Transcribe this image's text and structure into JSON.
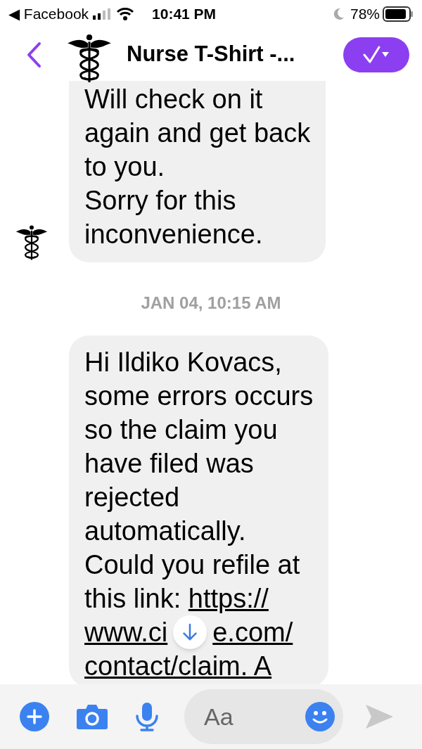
{
  "status_bar": {
    "back_app": "◀ Facebook",
    "time": "10:41 PM",
    "battery": "78%"
  },
  "header": {
    "title": "Nurse T-Shirt -..."
  },
  "messages": [
    {
      "kind": "bubble",
      "avatar": true,
      "lines": [
        [
          {
            "text": "Will check on it"
          }
        ],
        [
          {
            "text": "again and get back"
          }
        ],
        [
          {
            "text": "to you."
          }
        ],
        [
          {
            "text": "Sorry for this"
          }
        ],
        [
          {
            "text": "inconvenience."
          }
        ]
      ]
    },
    {
      "kind": "timestamp",
      "text": "JAN 04, 10:15 AM"
    },
    {
      "kind": "bubble",
      "avatar": false,
      "lines": [
        [
          {
            "text": "Hi Ildiko Kovacs,"
          }
        ],
        [
          {
            "text": "some errors occurs"
          }
        ],
        [
          {
            "text": "so the claim you"
          }
        ],
        [
          {
            "text": "have filed was"
          }
        ],
        [
          {
            "text": "rejected"
          }
        ],
        [
          {
            "text": "automatically."
          }
        ],
        [
          {
            "text": "Could you refile at"
          }
        ],
        [
          {
            "text": "this link: "
          },
          {
            "text": "https://",
            "link": true
          }
        ],
        [
          {
            "text": "www.ci",
            "link": true
          },
          {
            "text": "e.com/",
            "link": true
          }
        ],
        [
          {
            "text": "contact/claim. A",
            "link": true
          }
        ]
      ]
    }
  ],
  "composer": {
    "placeholder": "Aa"
  }
}
